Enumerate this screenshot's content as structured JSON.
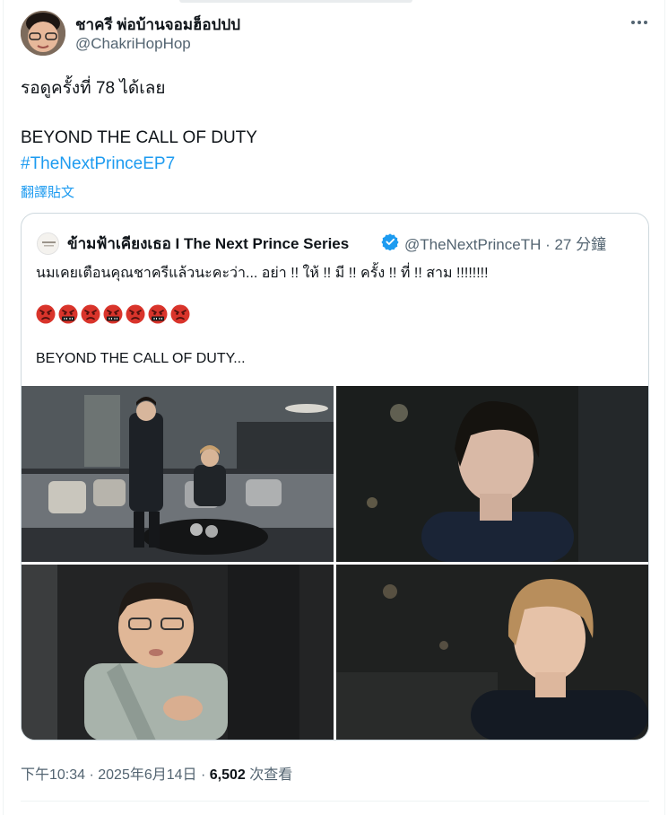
{
  "author": {
    "display_name": "ชาครี พ่อบ้านจอมฮ็อปปป",
    "handle": "@ChakriHopHop"
  },
  "tweet": {
    "line1": "รอดูครั้งที่ 78 ได้เลย",
    "line2": "BEYOND THE CALL OF DUTY",
    "hashtag": "#TheNextPrinceEP7",
    "translate_label": "翻譯貼文"
  },
  "quoted": {
    "display_name": "ข้ามฟ้าเคียงเธอ I The Next Prince Series",
    "meta": "@TheNextPrinceTH · 27 分鐘",
    "text": "นมเคยเตือนคุณชาครีแล้วนะคะว่า... อย่า !! ให้ !! มี !! ครั้ง !! ที่ !! สาม !!!!!!!!",
    "emojis": [
      "angry-face",
      "cursing-face",
      "angry-face",
      "cursing-face",
      "angry-face",
      "cursing-face",
      "angry-face"
    ],
    "text2": "BEYOND THE CALL OF DUTY..."
  },
  "footer": {
    "time": "下午10:34 · 2025年6月14日 · ",
    "views_count": "6,502",
    "views_label": " 次查看"
  },
  "colors": {
    "link": "#1d9bf0",
    "secondary": "#536471",
    "border": "#cfd9de"
  }
}
